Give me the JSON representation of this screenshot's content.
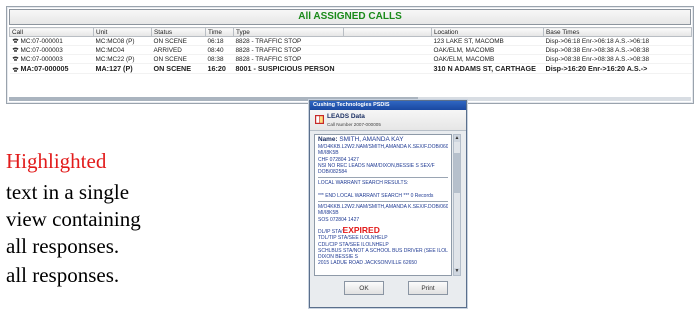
{
  "calls": {
    "title": "All ASSIGNED CALLS",
    "columns": [
      "Call",
      "Unit",
      "Status",
      "Time",
      "Type",
      "",
      "Location",
      "Base Times"
    ],
    "rows": [
      [
        "MC:07-000001",
        "MC:MC08 (P)",
        "ON SCENE",
        "06:18",
        "8828 - TRAFFIC STOP",
        "",
        "123 LAKE ST, MACOMB",
        "Disp->06:18 Enr->06:18 A.S.->06:18"
      ],
      [
        "MC:07-000003",
        "MC:MC04",
        "ARRIVED",
        "08:40",
        "8828 - TRAFFIC STOP",
        "",
        "OAK/ELM, MACOMB",
        "Disp->08:38 Enr->08:38 A.S.->08:38"
      ],
      [
        "MC:07-000003",
        "MC:MC22 (P)",
        "ON SCENE",
        "08:38",
        "8828 - TRAFFIC STOP",
        "",
        "OAK/ELM, MACOMB",
        "Disp->08:38 Enr->08:38 A.S.->08:38"
      ],
      [
        "MA:07-000005",
        "MA:127 (P)",
        "ON SCENE",
        "16:20",
        "8001 - SUSPICIOUS PERSON",
        "",
        "310 N ADAMS ST, CARTHAGE",
        "Disp->16:20 Enr->16:20 A.S.->"
      ]
    ]
  },
  "caption": {
    "line1": "Highlighted",
    "line2": "text in a single",
    "line3": "view containing",
    "line4": "all responses."
  },
  "dialog": {
    "titlebar": "Cushing Technologies PSDIS",
    "header_title": "LEADS Data",
    "header_sub": "Call Number 2007-000005",
    "lines": {
      "name_label": "Name:",
      "name_value": "SMITH, AMANDA KAY",
      "l1": "M/O4KKB.L2W2.NAM/SMITH,AMANDA K.SEX/F.DOB/060078.",
      "l2": "MI/I8K5B",
      "l3": "CHF 072804 1427",
      "l4": "NSI NO REC LEADS NAM/DIXON,BESSIE S SEX/F",
      "l5": "DOB/082584",
      "l6": "LOCAL WARRANT SEARCH RESULTS:",
      "l7": "*** END LOCAL WARRANT SEARCH *** 0 Records",
      "l8": "M/O4KKB.L2W2.NAM/SMITH,AMANDA K.SEX/F.DOB/060078.",
      "l9": "MI/I8K5B",
      "l10": "SOS 072804 1427",
      "dl_prefix": "DL/IP STA/",
      "dl_status": "EXPIRED",
      "l11": "TDL/TIP STA/SEE ILOLNHELP",
      "l12": "CDL/CIP STA/SEE ILOLNHELP",
      "l13": "SCHLBUS STA/NOT A SCHOOL BUS DRIVER (SEE ILOLNHELP)",
      "l14": "DIXON BESSIE S",
      "l15": "2015 LADUE ROAD JACKSONVILLE 62650"
    },
    "ok_label": "OK",
    "print_label": "Print"
  },
  "colors": {
    "title_green": "#1a8a1a",
    "highlight_red": "#e21b1b",
    "leads_blue": "#1f3a93"
  }
}
